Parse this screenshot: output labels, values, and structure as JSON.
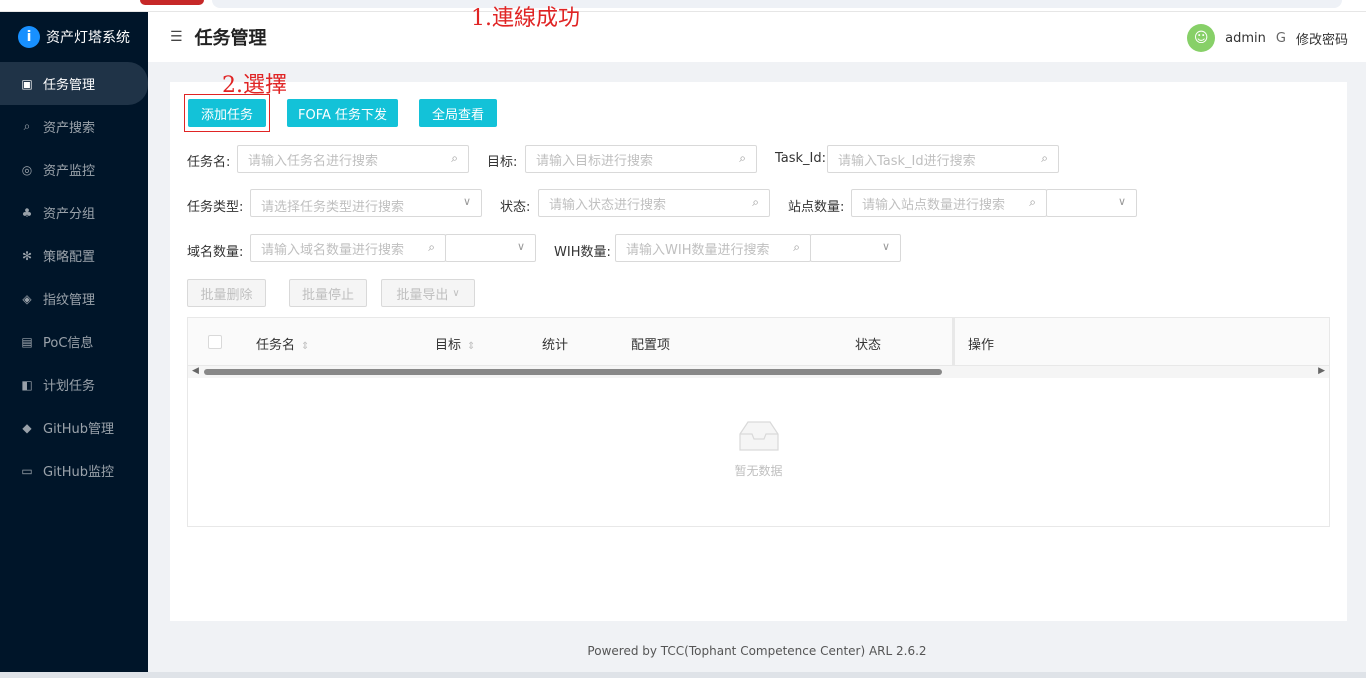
{
  "app": {
    "brand": "资产灯塔系统"
  },
  "sidebar": {
    "items": [
      {
        "label": "任务管理",
        "icon": "clipboard-icon",
        "glyph": "▣"
      },
      {
        "label": "资产搜索",
        "icon": "search-icon",
        "glyph": "⌕"
      },
      {
        "label": "资产监控",
        "icon": "shield-icon",
        "glyph": "◎"
      },
      {
        "label": "资产分组",
        "icon": "cluster-icon",
        "glyph": "♣"
      },
      {
        "label": "策略配置",
        "icon": "settings-icon",
        "glyph": "✻"
      },
      {
        "label": "指纹管理",
        "icon": "fingerprint-icon",
        "glyph": "◈"
      },
      {
        "label": "PoC信息",
        "icon": "file-icon",
        "glyph": "▤"
      },
      {
        "label": "计划任务",
        "icon": "schedule-icon",
        "glyph": "◧"
      },
      {
        "label": "GitHub管理",
        "icon": "github-icon",
        "glyph": "◆"
      },
      {
        "label": "GitHub监控",
        "icon": "monitor-icon",
        "glyph": "▭"
      }
    ]
  },
  "header": {
    "title": "任务管理",
    "user": "admin",
    "logout_icon": "logout-icon",
    "change_password": "修改密码"
  },
  "annotations": {
    "step1": "1.連線成功",
    "step2": "2.選擇"
  },
  "toolbar": {
    "add_task": "添加任务",
    "fofa_task": "FOFA 任务下发",
    "global_view": "全局查看"
  },
  "filters": {
    "task_name": {
      "label": "任务名:",
      "placeholder": "请输入任务名进行搜索"
    },
    "target": {
      "label": "目标:",
      "placeholder": "请输入目标进行搜索"
    },
    "task_id": {
      "label": "Task_Id:",
      "placeholder": "请输入Task_Id进行搜索"
    },
    "task_type": {
      "label": "任务类型:",
      "placeholder": "请选择任务类型进行搜索"
    },
    "status": {
      "label": "状态:",
      "placeholder": "请输入状态进行搜索"
    },
    "site_count": {
      "label": "站点数量:",
      "placeholder": "请输入站点数量进行搜索"
    },
    "domain_count": {
      "label": "域名数量:",
      "placeholder": "请输入域名数量进行搜索"
    },
    "wih_count": {
      "label": "WIH数量:",
      "placeholder": "请输入WIH数量进行搜索"
    }
  },
  "batch": {
    "delete": "批量删除",
    "stop": "批量停止",
    "export": "批量导出"
  },
  "table": {
    "columns": [
      "任务名",
      "目标",
      "统计",
      "配置项",
      "状态",
      "操作"
    ],
    "empty_text": "暂无数据"
  },
  "footer": "Powered by TCC(Tophant Competence Center) ARL 2.6.2"
}
